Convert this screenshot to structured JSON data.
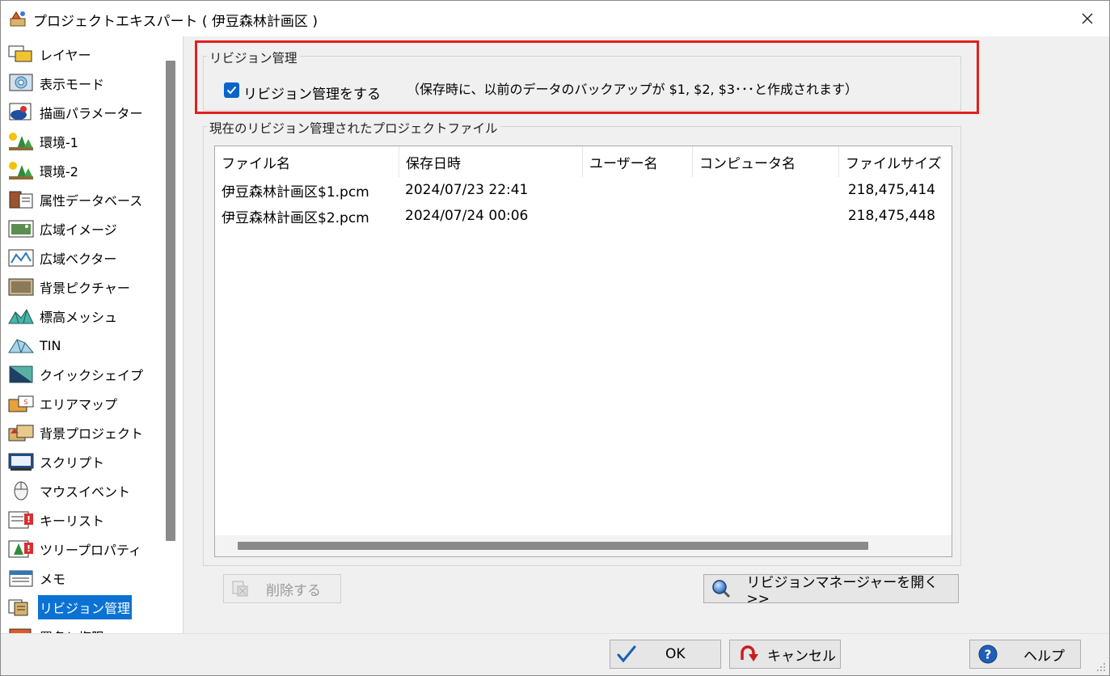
{
  "window": {
    "title": "プロジェクトエキスパート ( 伊豆森林計画区 )"
  },
  "sidebar": {
    "items": [
      {
        "label": "レイヤー",
        "icon": "layers-icon"
      },
      {
        "label": "表示モード",
        "icon": "display-mode-icon"
      },
      {
        "label": "描画パラメーター",
        "icon": "paint-palette-icon"
      },
      {
        "label": "環境-1",
        "icon": "environment-icon"
      },
      {
        "label": "環境-2",
        "icon": "environment-icon"
      },
      {
        "label": "属性データベース",
        "icon": "database-book-icon"
      },
      {
        "label": "広域イメージ",
        "icon": "wide-image-icon"
      },
      {
        "label": "広域ベクター",
        "icon": "wide-vector-icon"
      },
      {
        "label": "背景ピクチャー",
        "icon": "background-picture-icon"
      },
      {
        "label": "標高メッシュ",
        "icon": "elevation-mesh-icon"
      },
      {
        "label": "TIN",
        "icon": "tin-icon"
      },
      {
        "label": "クイックシェイプ",
        "icon": "quick-shape-icon"
      },
      {
        "label": "エリアマップ",
        "icon": "area-map-icon"
      },
      {
        "label": "背景プロジェクト",
        "icon": "background-project-icon"
      },
      {
        "label": "スクリプト",
        "icon": "script-icon"
      },
      {
        "label": "マウスイベント",
        "icon": "mouse-icon"
      },
      {
        "label": "キーリスト",
        "icon": "key-list-icon"
      },
      {
        "label": "ツリープロパティ",
        "icon": "tree-property-icon"
      },
      {
        "label": "メモ",
        "icon": "memo-icon"
      },
      {
        "label": "リビジョン管理",
        "icon": "revision-icon"
      },
      {
        "label": "署名と権限",
        "icon": "signature-icon"
      }
    ],
    "selected_index": 19
  },
  "revision": {
    "group_title": "リビジョン管理",
    "checkbox_label": "リビジョン管理をする",
    "checked": true,
    "note": "（保存時に、以前のデータのバックアップが $1, $2, $3･･･と作成されます）"
  },
  "files": {
    "group_title": "現在のリビジョン管理されたプロジェクトファイル",
    "columns": [
      "ファイル名",
      "保存日時",
      "ユーザー名",
      "コンピュータ名",
      "ファイルサイズ"
    ],
    "rows": [
      {
        "name": "伊豆森林計画区$1.pcm",
        "date": "2024/07/23 22:41",
        "user": "",
        "computer": "",
        "size": "218,475,414"
      },
      {
        "name": "伊豆森林計画区$2.pcm",
        "date": "2024/07/24 00:06",
        "user": "",
        "computer": "",
        "size": "218,475,448"
      }
    ]
  },
  "buttons": {
    "delete": "削除する",
    "open_manager": "リビジョンマネージャーを開く >>",
    "ok": "OK",
    "cancel": "キャンセル",
    "help": "ヘルプ"
  },
  "colors": {
    "accent": "#0b72d4",
    "highlight_box": "#e02020",
    "checkbox": "#0a63c9"
  }
}
